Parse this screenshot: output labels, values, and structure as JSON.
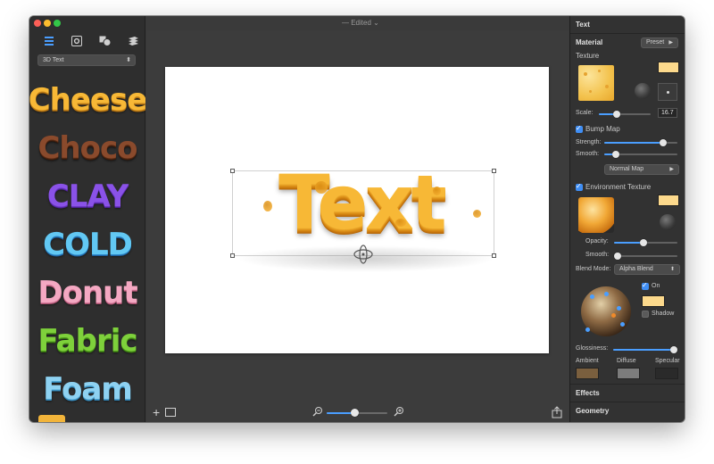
{
  "window": {
    "doc_title": "— Edited"
  },
  "sidebar": {
    "tabs": [
      {
        "icon": "list-icon",
        "active": true
      },
      {
        "icon": "settings-box-icon",
        "active": false
      },
      {
        "icon": "shapes-icon",
        "active": false
      },
      {
        "icon": "layers-icon",
        "active": false
      }
    ],
    "category_select": "3D Text",
    "presets": [
      "Cheese",
      "Choco",
      "CLAY",
      "COLD",
      "Donut",
      "Fabric",
      "Foam"
    ]
  },
  "canvas": {
    "text": "Text"
  },
  "bottom_bar": {
    "zoom_level": 0.45
  },
  "inspector": {
    "header": "Text",
    "material": {
      "title": "Material",
      "preset_button": "Preset",
      "texture_label": "Texture"
    },
    "scale": {
      "label": "Scale:",
      "value": "16.7"
    },
    "bump_map": {
      "label": "Bump Map",
      "checked": true,
      "strength_label": "Strength:",
      "smooth_label": "Smooth:",
      "map_type": "Normal Map"
    },
    "environment": {
      "label": "Environment Texture",
      "checked": true,
      "opacity_label": "Opacity:",
      "smooth_label": "Smooth:",
      "blend_label": "Blend Mode:",
      "blend_value": "Alpha Blend"
    },
    "lighting": {
      "on_label": "On",
      "on_checked": true,
      "shadow_label": "Shadow",
      "shadow_checked": false
    },
    "glossiness_label": "Glossiness:",
    "channels": [
      "Ambient",
      "Diffuse",
      "Specular"
    ],
    "sections": [
      "Effects",
      "Geometry"
    ],
    "colors": {
      "accent": "#4a9eff",
      "texture_tint": "#fcd98c",
      "ambient": "#7a5f3e",
      "diffuse": "#7c7c7c",
      "specular": "#2a2a2a"
    }
  }
}
